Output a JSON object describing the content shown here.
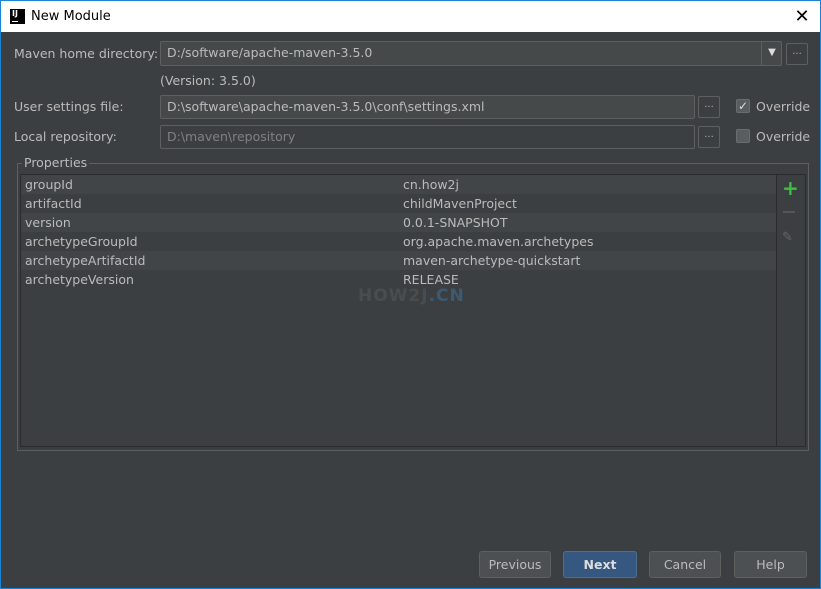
{
  "window": {
    "title": "New Module"
  },
  "form": {
    "maven_home_label": "Maven home directory:",
    "maven_home_value": "D:/software/apache-maven-3.5.0",
    "version_note": "(Version: 3.5.0)",
    "user_settings_label": "User settings file:",
    "user_settings_value": "D:\\software\\apache-maven-3.5.0\\conf\\settings.xml",
    "user_settings_override": "Override",
    "user_settings_override_checked": true,
    "local_repo_label": "Local repository:",
    "local_repo_value": "D:\\maven\\repository",
    "local_repo_override": "Override",
    "local_repo_override_checked": false,
    "browse": "..."
  },
  "properties": {
    "title": "Properties",
    "rows": [
      {
        "key": "groupId",
        "value": "cn.how2j"
      },
      {
        "key": "artifactId",
        "value": "childMavenProject"
      },
      {
        "key": "version",
        "value": "0.0.1-SNAPSHOT"
      },
      {
        "key": "archetypeGroupId",
        "value": "org.apache.maven.archetypes"
      },
      {
        "key": "archetypeArtifactId",
        "value": "maven-archetype-quickstart"
      },
      {
        "key": "archetypeVersion",
        "value": "RELEASE"
      }
    ]
  },
  "watermark": {
    "a": "HOW2J",
    "b": ".CN"
  },
  "buttons": {
    "previous": "Previous",
    "next": "Next",
    "cancel": "Cancel",
    "help": "Help"
  },
  "colors": {
    "accent": "#365880",
    "add": "#3fbf3f",
    "border": "#1883d7"
  }
}
